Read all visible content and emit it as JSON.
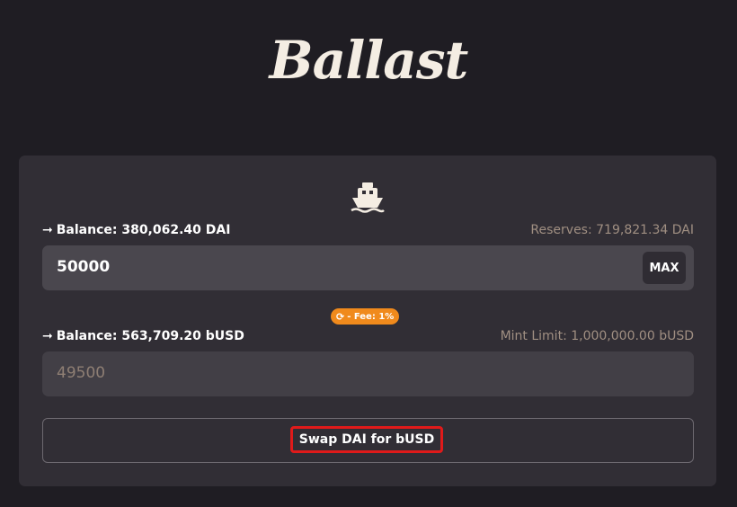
{
  "app": {
    "logo_text": "Ballast"
  },
  "from": {
    "balance_label": "Balance: 380,062.40 DAI",
    "reserves_label": "Reserves: 719,821.34 DAI",
    "input_value": "50000",
    "max_label": "MAX"
  },
  "fee": {
    "label": "- Fee: 1%"
  },
  "to": {
    "balance_label": "Balance: 563,709.20 bUSD",
    "mint_limit_label": "Mint Limit: 1,000,000.00 bUSD",
    "output_value": "49500"
  },
  "action": {
    "swap_label": "Swap DAI for bUSD"
  },
  "icons": {
    "ship": "ship-icon",
    "arrow": "arrow-right-icon",
    "swap": "swap-icon"
  },
  "colors": {
    "background": "#1f1d23",
    "card": "#312e35",
    "input": "#4a474e",
    "fee_pill": "#f08a1c",
    "highlight_border": "#e01a1a",
    "muted_text": "#a08f82"
  }
}
